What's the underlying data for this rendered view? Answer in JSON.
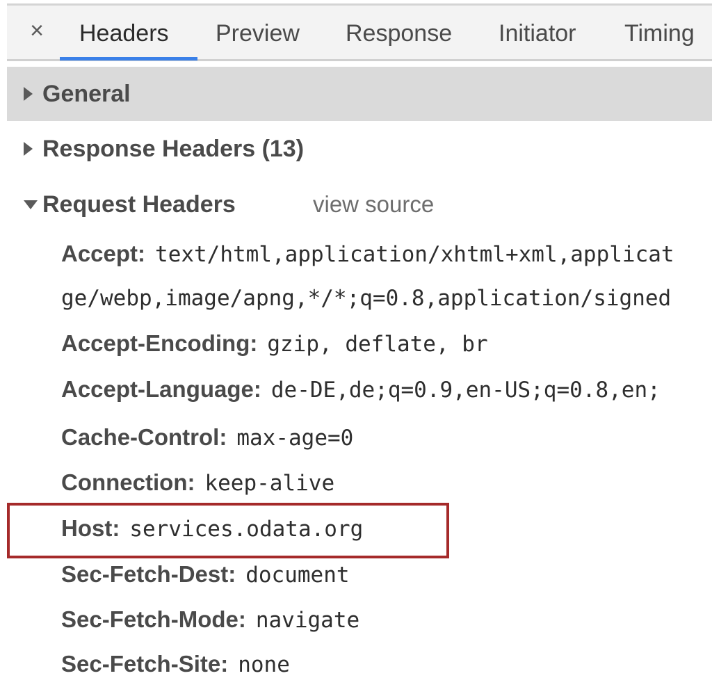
{
  "tabs": {
    "close_symbol": "×",
    "items": [
      {
        "label": "Headers",
        "active": true
      },
      {
        "label": "Preview",
        "active": false
      },
      {
        "label": "Response",
        "active": false
      },
      {
        "label": "Initiator",
        "active": false
      },
      {
        "label": "Timing",
        "active": false
      }
    ]
  },
  "sections": {
    "general": {
      "label": "General",
      "expanded": false
    },
    "response_headers": {
      "label": "Response Headers (13)",
      "expanded": false
    },
    "request_headers": {
      "label": "Request Headers",
      "expanded": true,
      "view_source": "view source"
    }
  },
  "request_headers": [
    {
      "name": "Accept:",
      "value": "text/html,application/xhtml+xml,applicat"
    },
    {
      "name": "",
      "value": "ge/webp,image/apng,*/*;q=0.8,application/signed"
    },
    {
      "name": "Accept-Encoding:",
      "value": "gzip, deflate, br"
    },
    {
      "name": "Accept-Language:",
      "value": "de-DE,de;q=0.9,en-US;q=0.8,en;"
    },
    {
      "name": "Cache-Control:",
      "value": "max-age=0"
    },
    {
      "name": "Connection:",
      "value": "keep-alive"
    },
    {
      "name": "Host:",
      "value": "services.odata.org",
      "highlighted": true
    },
    {
      "name": "Sec-Fetch-Dest:",
      "value": "document"
    },
    {
      "name": "Sec-Fetch-Mode:",
      "value": "navigate"
    },
    {
      "name": "Sec-Fetch-Site:",
      "value": "none"
    }
  ],
  "colors": {
    "active_tab_underline": "#3a80e8",
    "highlight_border": "#a52a2a",
    "general_row_bg": "#dadada",
    "tabbar_bg": "#f3f3f3"
  }
}
